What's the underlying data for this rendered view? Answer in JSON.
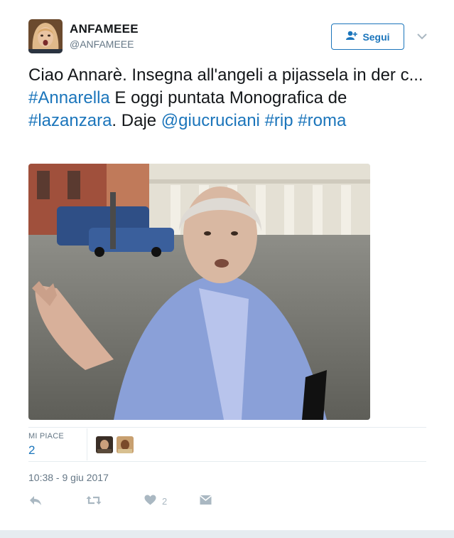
{
  "author": {
    "name": "ANFAMEEE",
    "handle": "@ANFAMEEE",
    "avatar_icon": "user-avatar"
  },
  "follow_button": {
    "label": "Segui",
    "icon": "follow-user-icon"
  },
  "menu_icon": "chevron-down-icon",
  "tweet": {
    "segments": [
      {
        "text": "Ciao Annarè. Insegna all'angeli a pijassela in der c... ",
        "type": "text"
      },
      {
        "text": "#Annarella",
        "type": "link"
      },
      {
        "text": " E oggi puntata Monografica de ",
        "type": "text"
      },
      {
        "text": "#lazanzara",
        "type": "link"
      },
      {
        "text": ". Daje ",
        "type": "text"
      },
      {
        "text": "@giucruciani",
        "type": "link"
      },
      {
        "text": " ",
        "type": "text"
      },
      {
        "text": "#rip",
        "type": "link"
      },
      {
        "text": " ",
        "type": "text"
      },
      {
        "text": "#roma",
        "type": "link"
      }
    ]
  },
  "stats": {
    "likes_label": "MI PIACE",
    "likes_count": "2"
  },
  "timestamp": "10:38 - 9 giu 2017",
  "actions": {
    "reply_icon": "reply-icon",
    "retweet_icon": "retweet-icon",
    "like_icon": "heart-icon",
    "like_count": "2",
    "dm_icon": "envelope-icon"
  },
  "colors": {
    "link": "#1b75bb",
    "muted": "#657786",
    "icon": "#aab8c2",
    "border": "#e6ecf0"
  }
}
